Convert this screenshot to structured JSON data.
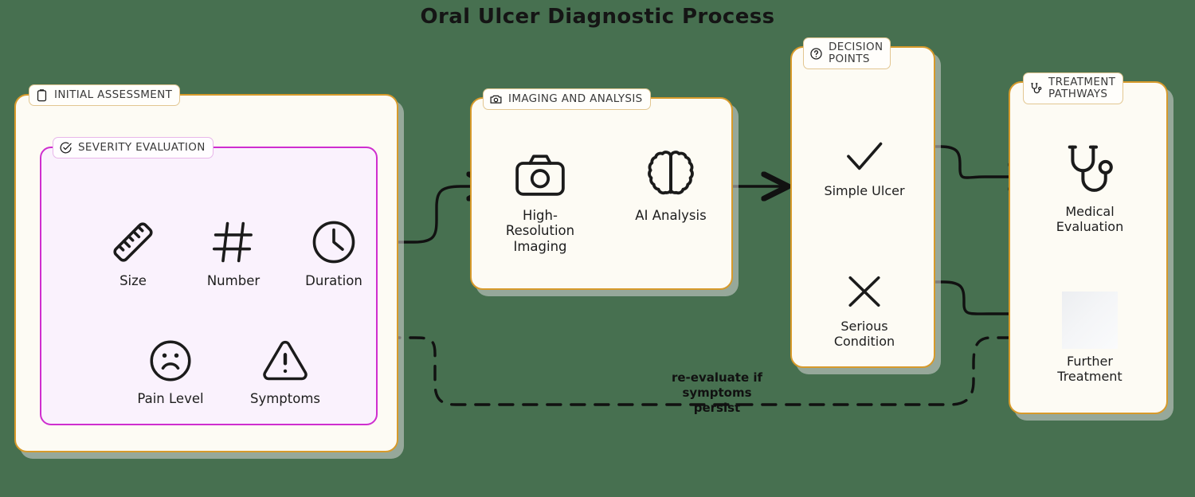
{
  "page": {
    "title": "Oral Ulcer Diagnostic Process",
    "background_color": "#477050",
    "panel_fill": "#fdfbf4",
    "panel_border": "#d79a2b",
    "inner_fill": "#faf2fd",
    "inner_border": "#cf2ecf",
    "line_color": "#111111"
  },
  "sections": {
    "initial_assessment": {
      "badge_label": "INITIAL ASSESSMENT",
      "badge_icon": "clipboard-icon",
      "inner": {
        "badge_label": "SEVERITY EVALUATION",
        "badge_icon": "check-circle-icon",
        "nodes": [
          {
            "label": "Size",
            "icon": "ruler-icon"
          },
          {
            "label": "Number",
            "icon": "hash-icon"
          },
          {
            "label": "Duration",
            "icon": "clock-icon"
          },
          {
            "label": "Pain Level",
            "icon": "sad-face-icon"
          },
          {
            "label": "Symptoms",
            "icon": "warning-triangle-icon"
          }
        ]
      }
    },
    "imaging_and_analysis": {
      "badge_label": "IMAGING AND ANALYSIS",
      "badge_icon": "camera-icon",
      "nodes": [
        {
          "label": "High-\nResolution\nImaging",
          "icon": "camera-icon"
        },
        {
          "label": "AI Analysis",
          "icon": "brain-icon"
        }
      ]
    },
    "decision_points": {
      "badge_label": "DECISION\nPOINTS",
      "badge_icon": "question-circle-icon",
      "nodes": [
        {
          "label": "Simple Ulcer",
          "icon": "check-icon"
        },
        {
          "label": "Serious\nCondition",
          "icon": "cross-icon"
        }
      ]
    },
    "treatment_pathways": {
      "badge_label": "TREATMENT\nPATHWAYS",
      "badge_icon": "stethoscope-icon",
      "nodes": [
        {
          "label": "Medical\nEvaluation",
          "icon": "stethoscope-icon"
        },
        {
          "label": "Further\nTreatment",
          "icon": "missing-image-placeholder"
        }
      ]
    }
  },
  "feedback_loop": {
    "label": "re-evaluate if\nsymptoms\npersist",
    "style": "dashed"
  }
}
